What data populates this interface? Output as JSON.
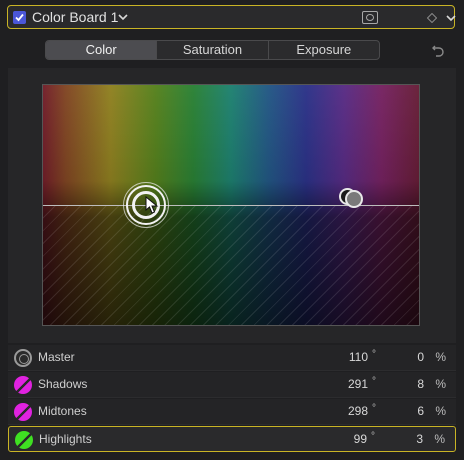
{
  "header": {
    "title": "Color Board 1",
    "enabled": true,
    "accent_color": "#c9b425",
    "checkbox_color": "#4b57d8"
  },
  "tabs": [
    {
      "label": "Color",
      "active": true
    },
    {
      "label": "Saturation",
      "active": false
    },
    {
      "label": "Exposure",
      "active": false
    }
  ],
  "rows": [
    {
      "label": "Master",
      "angle": "110",
      "angle_unit": "°",
      "percent": "0",
      "percent_unit": "%",
      "icon": "master-ring-icon",
      "color": "#9a9a9a",
      "selected": false
    },
    {
      "label": "Shadows",
      "angle": "291",
      "angle_unit": "°",
      "percent": "8",
      "percent_unit": "%",
      "icon": "shadows-swatch-icon",
      "color": "#e022e0",
      "selected": false
    },
    {
      "label": "Midtones",
      "angle": "298",
      "angle_unit": "°",
      "percent": "6",
      "percent_unit": "%",
      "icon": "midtones-swatch-icon",
      "color": "#e022e0",
      "selected": false
    },
    {
      "label": "Highlights",
      "angle": "99",
      "angle_unit": "°",
      "percent": "3",
      "percent_unit": "%",
      "icon": "highlights-swatch-icon",
      "color": "#3fe022",
      "selected": true
    }
  ]
}
